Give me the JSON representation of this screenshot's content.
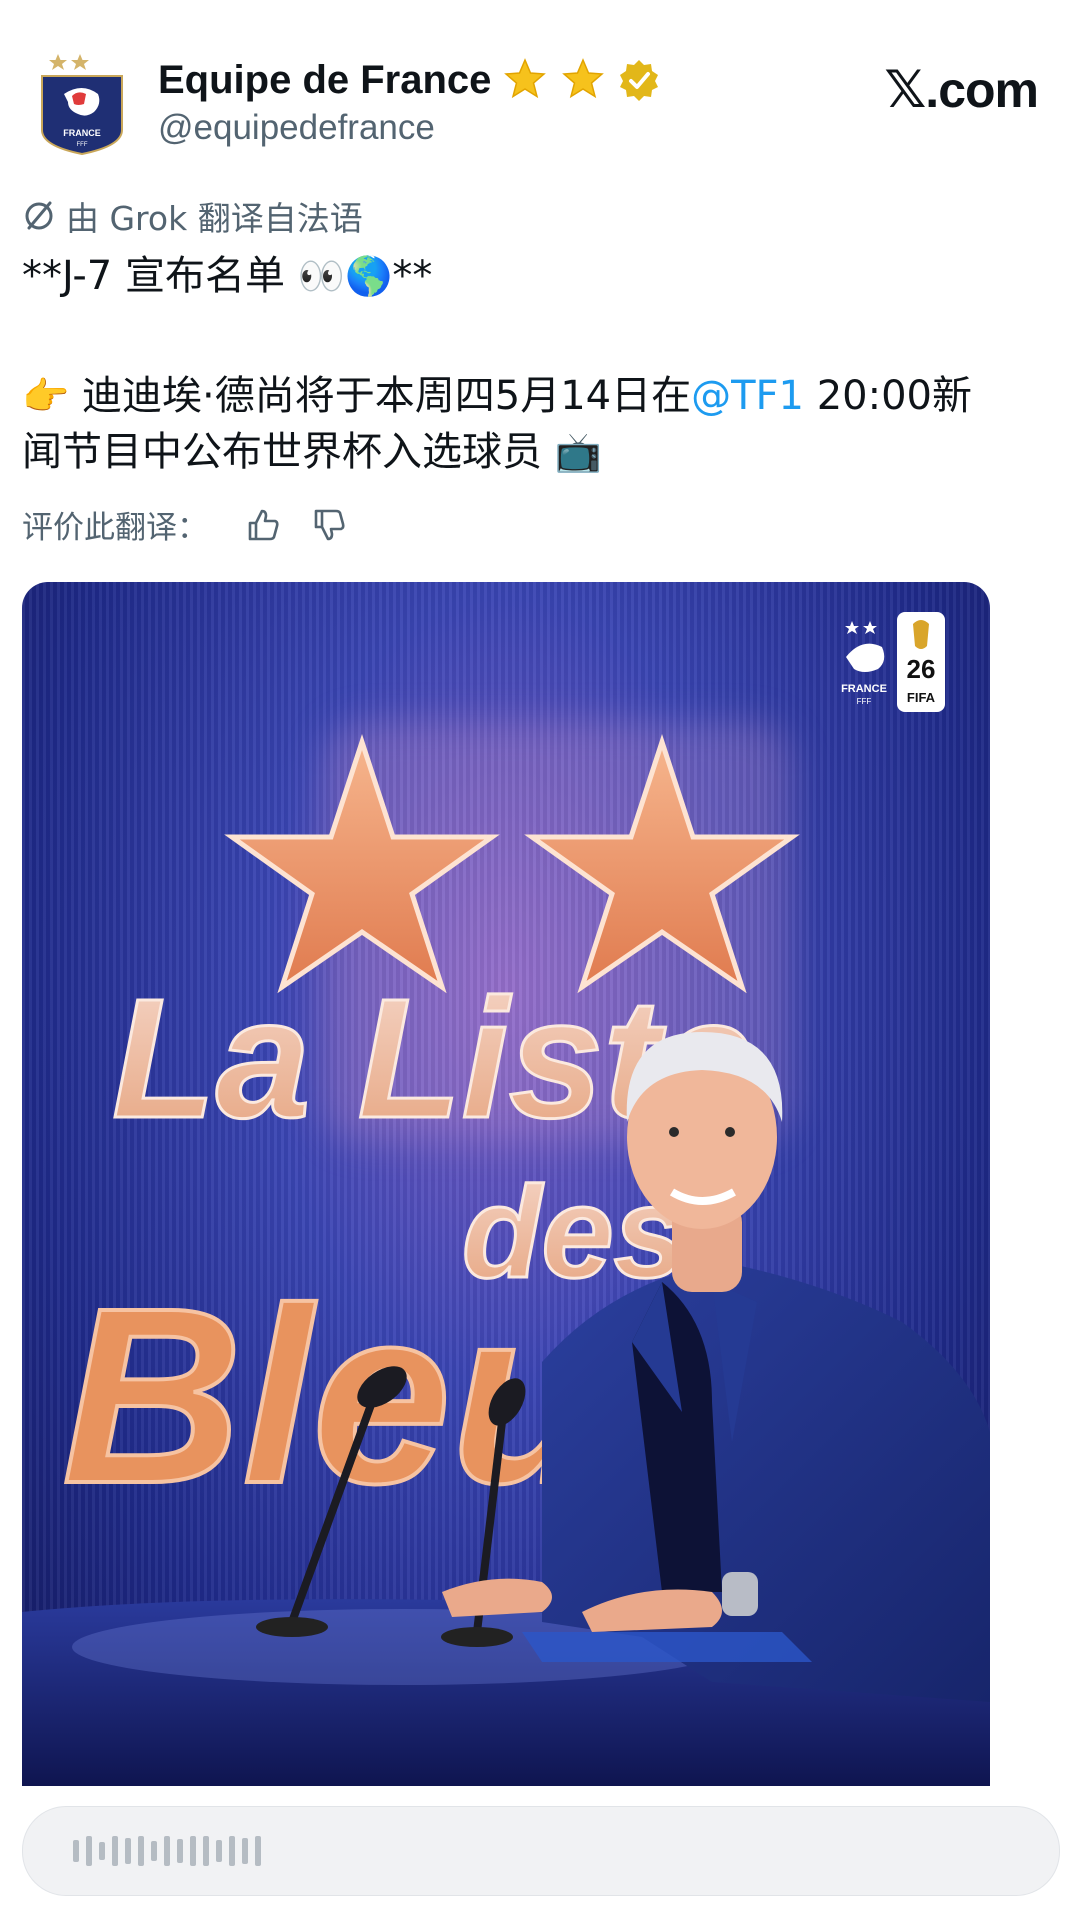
{
  "post": {
    "display_name": "Equipe de France",
    "handle": "@equipedefrance",
    "avatar_text": "FRANCE",
    "avatar_subtext": "FFF"
  },
  "site": {
    "x_mark": "𝕏",
    "domain_suffix": ".com"
  },
  "translation": {
    "note": "由 Grok 翻译自法语"
  },
  "tweet": {
    "line1_prefix": "**J-7 宣布名单 ",
    "line1_emoji": "👀🌎",
    "line1_suffix": "**",
    "line3_emoji": "👉",
    "line3_text": " 迪迪埃·德尚将于本周四5月14日在",
    "mention": "@TF1",
    "line3_after": " 20:00新",
    "line4_text": "闻节目中公布世界杯入选球员 ",
    "line4_emoji": "📺"
  },
  "rating": {
    "label": "评价此翻译："
  },
  "media": {
    "title_line1": "La Liste",
    "title_line2": "des",
    "title_line3": "Bleus",
    "federation_logo_text": "FRANCE",
    "federation_logo_subtext": "FFF",
    "competition_logo_text": "FIFA",
    "competition_logo_number": "26"
  },
  "reply": {
    "placeholder": ""
  },
  "icons": {
    "translate": "translate-icon",
    "thumb_up": "thumbs-up-icon",
    "thumb_down": "thumbs-down-icon",
    "verified": "verified-badge-icon",
    "star": "star-badge-icon"
  },
  "colors": {
    "mention": "#1d9bf0",
    "verified": "#e2b719",
    "star": "#f6c21c",
    "muted_text": "#536471"
  }
}
